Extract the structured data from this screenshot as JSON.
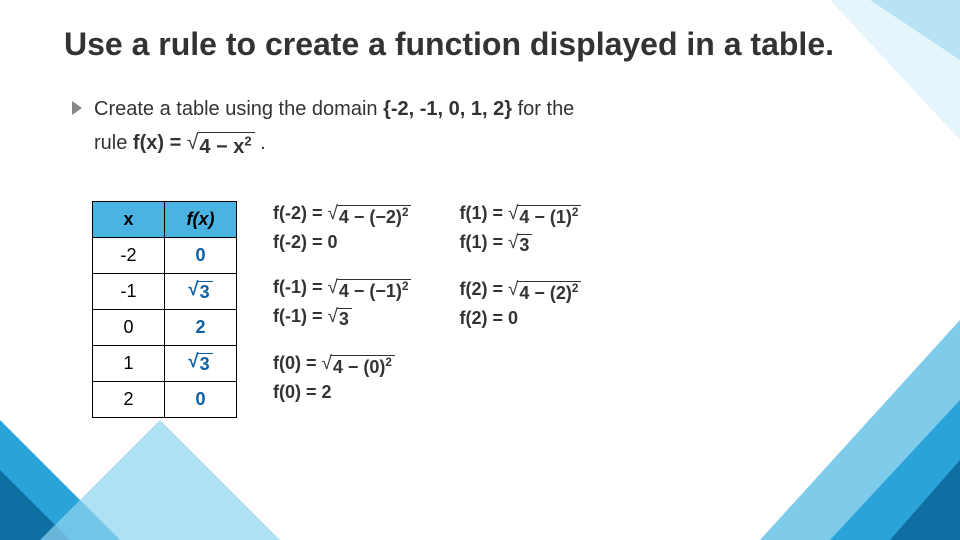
{
  "title": "Use a rule to create a function displayed in a table.",
  "bullet": {
    "prefix": "Create a table using the domain ",
    "domain": "{-2, -1, 0, 1, 2}",
    "mid": " for the",
    "line2_prefix": "rule ",
    "rule_lhs": "f(x) = ",
    "rule_rad": "4 − x",
    "rule_exp": "2",
    "suffix": " ."
  },
  "chart_data": {
    "type": "table",
    "columns": [
      "x",
      "f(x)"
    ],
    "rows": [
      {
        "x": "-2",
        "fx": "0",
        "fx_sqrt": null
      },
      {
        "x": "-1",
        "fx": null,
        "fx_sqrt": "3"
      },
      {
        "x": "0",
        "fx": "2",
        "fx_sqrt": null
      },
      {
        "x": "1",
        "fx": null,
        "fx_sqrt": "3"
      },
      {
        "x": "2",
        "fx": "0",
        "fx_sqrt": null
      }
    ]
  },
  "work": {
    "left": [
      {
        "lines": [
          {
            "lhs": "f(-2) = ",
            "rad": "4 − (−2)",
            "exp": "2"
          },
          {
            "lhs": "f(-2) = ",
            "plain": "0"
          }
        ]
      },
      {
        "lines": [
          {
            "lhs": "f(-1) = ",
            "rad": "4 − (−1)",
            "exp": "2"
          },
          {
            "lhs": "f(-1) = ",
            "rad": "3"
          }
        ]
      },
      {
        "lines": [
          {
            "lhs": "f(0) = ",
            "rad": "4 − (0)",
            "exp": "2"
          },
          {
            "lhs": "f(0) = ",
            "plain": "2"
          }
        ]
      }
    ],
    "right": [
      {
        "lines": [
          {
            "lhs": "f(1) = ",
            "rad": "4 − (1)",
            "exp": "2"
          },
          {
            "lhs": "f(1) = ",
            "rad": "3"
          }
        ]
      },
      {
        "lines": [
          {
            "lhs": "f(2) = ",
            "rad": "4 − (2)",
            "exp": "2"
          },
          {
            "lhs": "f(2) = ",
            "plain": "0"
          }
        ]
      }
    ]
  }
}
